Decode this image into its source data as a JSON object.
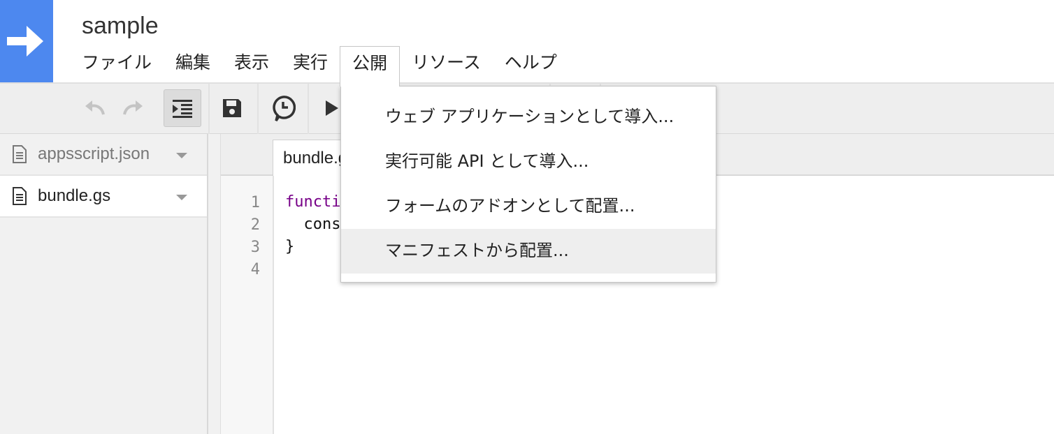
{
  "header": {
    "title": "sample"
  },
  "menubar": {
    "items": [
      "ファイル",
      "編集",
      "表示",
      "実行",
      "公開",
      "リソース",
      "ヘルプ"
    ],
    "active_index": 4
  },
  "dropdown": {
    "items": [
      "ウェブ アプリケーションとして導入...",
      "実行可能 API として導入...",
      "フォームのアドオンとして配置...",
      "マニフェストから配置..."
    ],
    "highlighted_index": 3
  },
  "sidebar": {
    "files": [
      {
        "name": "appsscript.json"
      },
      {
        "name": "bundle.gs"
      }
    ],
    "selected_index": 1
  },
  "editor": {
    "tab_label": "bundle.gs",
    "line_numbers": [
      "1",
      "2",
      "3",
      "4"
    ],
    "code": {
      "line1_kw": "functi",
      "line2": "  cons",
      "line3": "}"
    }
  },
  "colors": {
    "logo_bg": "#4d88ef",
    "keyword": "#770088",
    "menu_highlight": "#eeeeee"
  },
  "icons": [
    "arrow-right-icon",
    "undo-icon",
    "redo-icon",
    "indent-icon",
    "save-icon",
    "clock-icon",
    "play-icon",
    "file-icon"
  ]
}
